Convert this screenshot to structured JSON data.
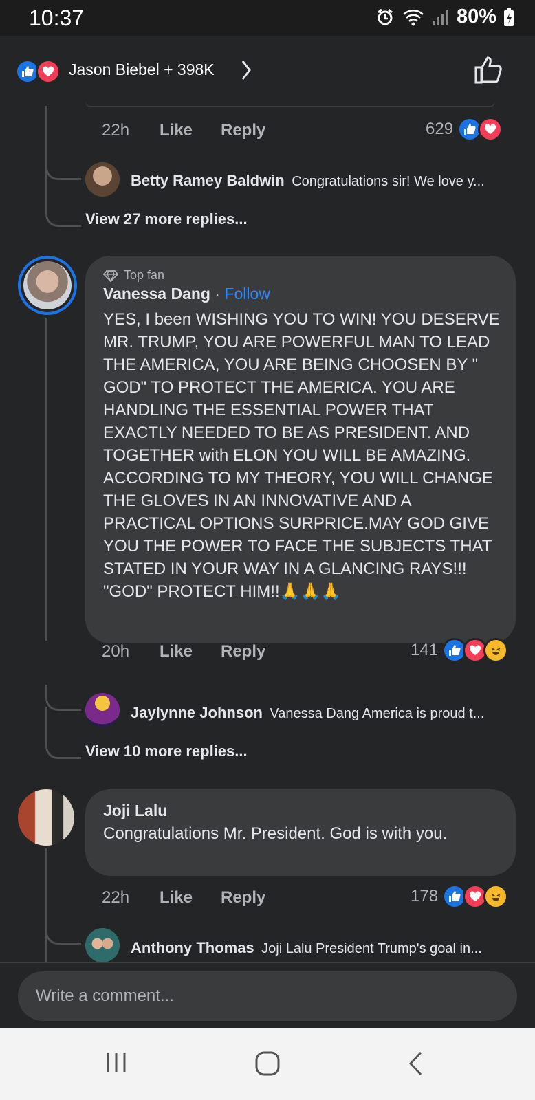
{
  "status_bar": {
    "time": "10:37",
    "battery": "80%"
  },
  "header": {
    "reactors": "Jason Biebel + 398K",
    "icons": [
      "like-reaction-icon",
      "love-reaction-icon",
      "chevron-right-icon",
      "like-button-icon"
    ]
  },
  "colors": {
    "background": "#242526",
    "bubble": "#3a3b3c",
    "like_blue": "#1b74e4",
    "love_red": "#f33e58",
    "haha_yellow": "#f7b928",
    "follow_blue": "#2d88ff"
  },
  "comments": [
    {
      "time": "22h",
      "like": "Like",
      "reply": "Reply",
      "reaction_count": "629",
      "replies": [
        {
          "name": "Betty Ramey Baldwin",
          "text": "Congratulations sir! We love y..."
        }
      ],
      "view_more": "View 27 more replies..."
    },
    {
      "badge": "Top fan",
      "name": "Vanessa Dang",
      "separator": "·",
      "follow": "Follow",
      "text": "YES, I been WISHING YOU TO WIN! YOU DESERVE MR. TRUMP, YOU ARE POWERFUL MAN TO LEAD THE AMERICA, YOU ARE BEING CHOOSEN BY \" GOD\" TO PROTECT THE AMERICA. YOU ARE HANDLING THE ESSENTIAL POWER THAT EXACTLY NEEDED TO BE AS PRESIDENT. AND TOGETHER with ELON YOU WILL BE AMAZING. ACCORDING TO MY THEORY, YOU WILL CHANGE THE GLOVES IN AN INNOVATIVE AND A PRACTICAL OPTIONS SURPRICE.MAY GOD GIVE YOU THE POWER TO FACE THE SUBJECTS THAT STATED IN YOUR WAY IN A GLANCING RAYS!!! \"GOD\" PROTECT HIM!!🙏🙏🙏",
      "time": "20h",
      "like": "Like",
      "reply": "Reply",
      "reaction_count": "141",
      "replies": [
        {
          "name": "Jaylynne Johnson",
          "text": "Vanessa Dang America is proud t..."
        }
      ],
      "view_more": "View 10 more replies..."
    },
    {
      "name": "Joji Lalu",
      "text": "Congratulations Mr. President. God is with you.",
      "time": "22h",
      "like": "Like",
      "reply": "Reply",
      "reaction_count": "178",
      "replies": [
        {
          "name": "Anthony Thomas",
          "text": "Joji Lalu President Trump's goal in..."
        }
      ]
    }
  ],
  "composer": {
    "placeholder": "Write a comment..."
  },
  "nav": {
    "icons": [
      "recents-icon",
      "home-icon",
      "back-icon"
    ]
  }
}
